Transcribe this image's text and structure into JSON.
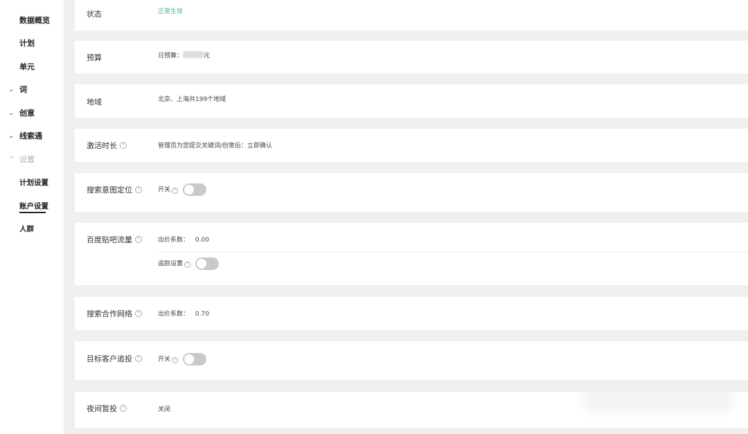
{
  "sidebar": {
    "items": [
      {
        "label": "数据概览",
        "chevron": ""
      },
      {
        "label": "计划",
        "chevron": ""
      },
      {
        "label": "单元",
        "chevron": ""
      },
      {
        "label": "词",
        "chevron": "⌄"
      },
      {
        "label": "创意",
        "chevron": "⌄"
      },
      {
        "label": "线索通",
        "chevron": "⌄"
      },
      {
        "label": "设置",
        "chevron": "^"
      },
      {
        "label": "计划设置",
        "chevron": ""
      },
      {
        "label": "账户设置",
        "chevron": ""
      },
      {
        "label": "人群",
        "chevron": ""
      }
    ],
    "active_item": "账户设置"
  },
  "settings": {
    "status": {
      "label": "状态",
      "value": "正常生效"
    },
    "budget": {
      "label": "预算",
      "prefix": "日预算：",
      "suffix": "元"
    },
    "region": {
      "label": "地域",
      "value": "北京、上海共199个地域"
    },
    "activation": {
      "label": "激活时长",
      "help": "?",
      "value": "管理员为您提交关键词/创意后：立即确认"
    },
    "search_intent": {
      "label": "搜索意图定位",
      "help": "?",
      "switch_label": "开关",
      "switch_on": false
    },
    "tieba": {
      "label": "百度贴吧流量",
      "help": "?",
      "bid_label": "出价系数：",
      "bid_value": "0.00",
      "tracking_label": "追踪设置",
      "tracking_on": false
    },
    "search_network": {
      "label": "搜索合作网络",
      "help": "?",
      "bid_label": "出价系数：",
      "bid_value": "0.70"
    },
    "target_customer": {
      "label": "目标客户追投",
      "help": "?",
      "switch_label": "开关",
      "switch_on": false
    },
    "night_pause": {
      "label": "夜间暂投",
      "help": "?",
      "value": "关闭"
    }
  },
  "colors": {
    "status_green": "#4bb37a",
    "toggle_off": "#c9c9c9",
    "page_bg": "#f0f0f0"
  }
}
